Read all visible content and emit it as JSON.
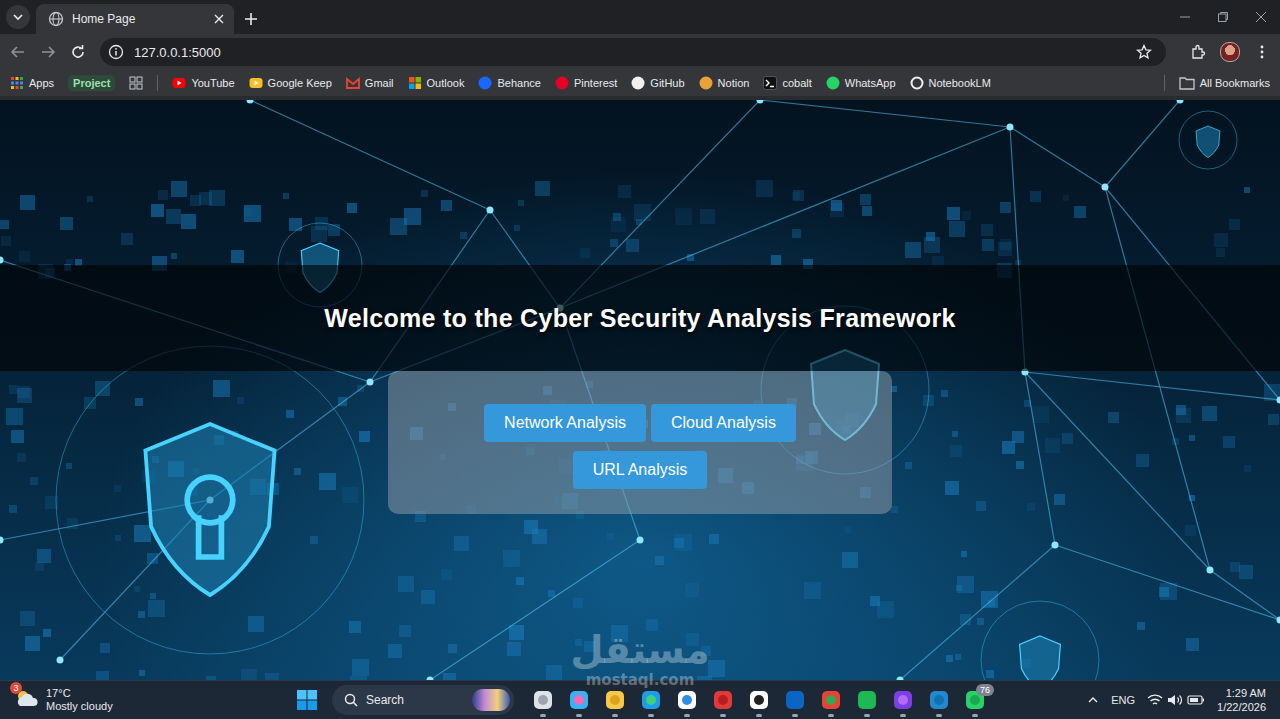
{
  "browser": {
    "tabs": [
      {
        "title": "Home Page",
        "selected": true
      }
    ],
    "address": "127.0.0.1:5000",
    "apps_label": "Apps",
    "chip": "Project",
    "bookmarks": [
      "YouTube",
      "Google Keep",
      "Gmail",
      "Outlook",
      "Behance",
      "Pinterest",
      "GitHub",
      "Notion",
      "cobalt",
      "WhatsApp",
      "NotebookLM"
    ],
    "all_bookmarks": "All Bookmarks"
  },
  "page": {
    "title": "Welcome to the Cyber Security Analysis Framework",
    "buttons": [
      "Network Analysis",
      "Cloud Analysis",
      "URL Analysis"
    ]
  },
  "watermark": {
    "arabic": "مستقل",
    "latin": "mostaql.com"
  },
  "taskbar": {
    "weather": {
      "temp": "17°C",
      "condition": "Mostly cloudy",
      "badge": "3"
    },
    "search": "Search",
    "whatsapp_badge": "76",
    "language": "ENG",
    "time": "1:29 AM",
    "date": "1/22/2026"
  }
}
